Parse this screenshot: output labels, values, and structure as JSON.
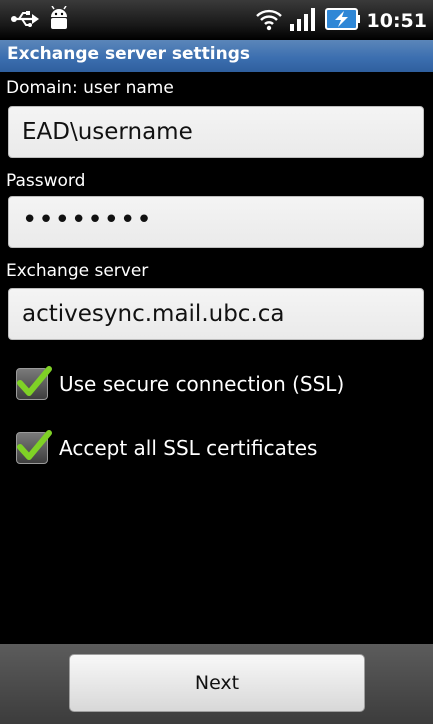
{
  "status_bar": {
    "time": "10:51",
    "icons": [
      "usb-icon",
      "android-debug-icon",
      "wifi-icon",
      "signal-icon",
      "battery-charging-icon"
    ]
  },
  "title_bar": {
    "title": "Exchange server settings"
  },
  "form": {
    "domain_username": {
      "label": "Domain: user name",
      "value": "EAD\\username"
    },
    "password": {
      "label": "Password",
      "value": "••••••••"
    },
    "exchange_server": {
      "label": "Exchange server",
      "value": "activesync.mail.ubc.ca"
    }
  },
  "options": {
    "use_ssl": {
      "label": "Use secure connection (SSL)",
      "checked": true
    },
    "accept_all_certs": {
      "label": "Accept all SSL certificates",
      "checked": true
    }
  },
  "bottom_bar": {
    "next_label": "Next"
  },
  "colors": {
    "title_bar": "#3c6fb0",
    "checkmark": "#7fd126",
    "background": "#000000"
  }
}
